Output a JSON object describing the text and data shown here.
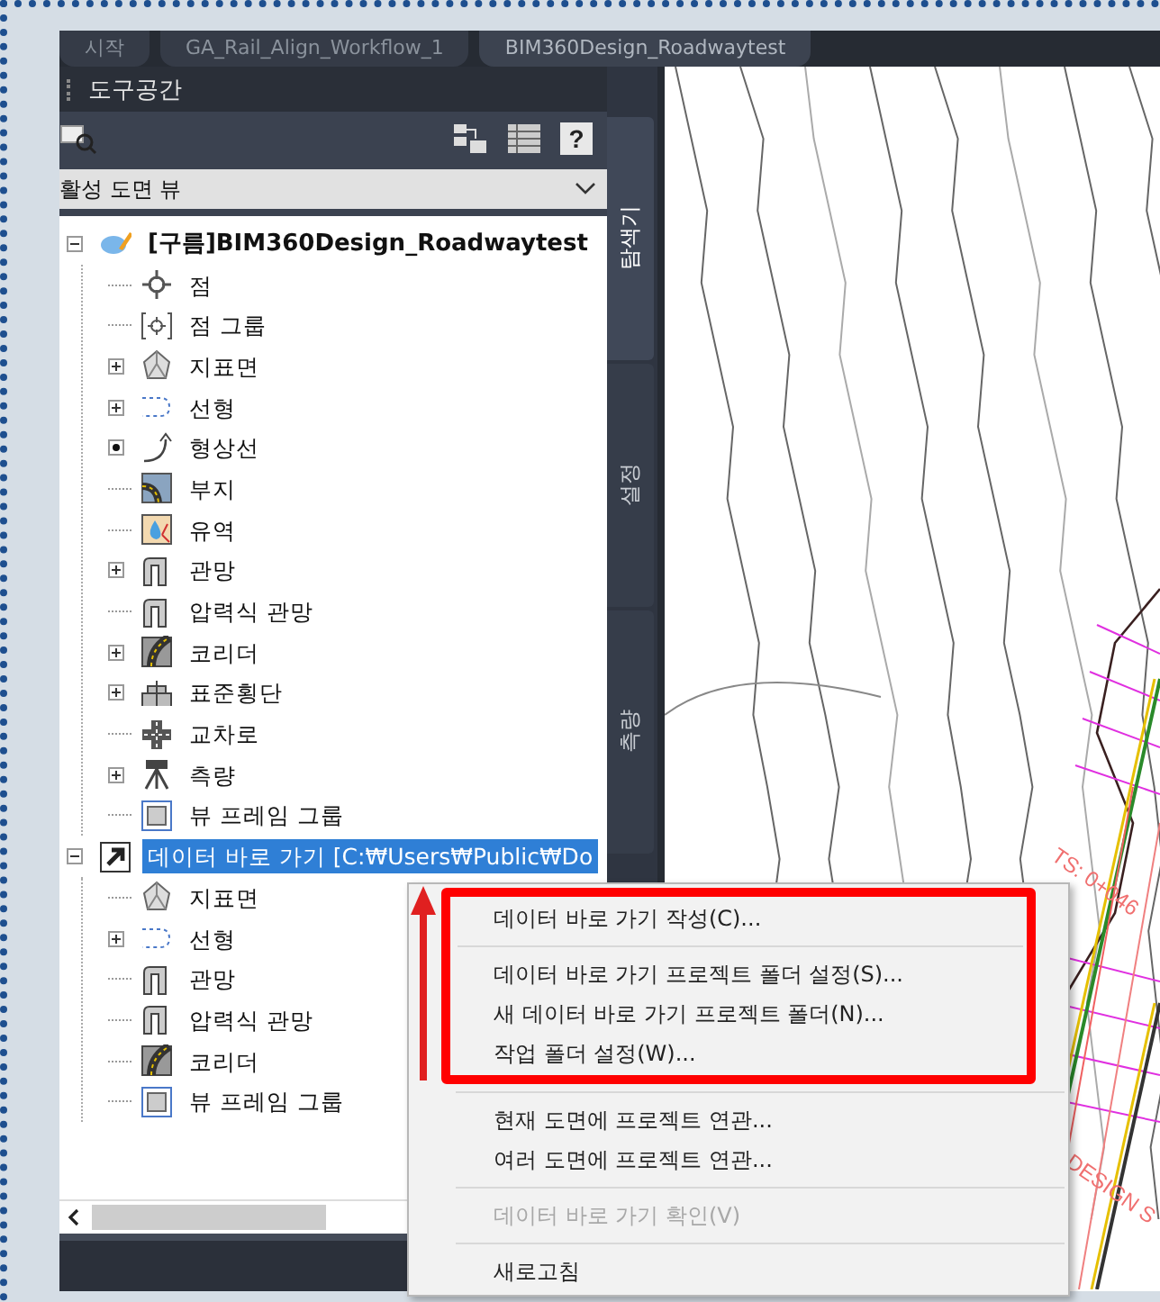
{
  "tabs": [
    {
      "label": "시작",
      "selected": false
    },
    {
      "label": "GA_Rail_Align_Workflow_1",
      "selected": false
    },
    {
      "label": "BIM360Design_Roadwaytest",
      "selected": true
    }
  ],
  "toolspace": {
    "title": "도구공간",
    "help_button": "?",
    "view_dropdown": {
      "value": "활성 도면 뷰"
    },
    "tree": [
      {
        "label": "[구름]BIM360Design_Roadwaytest",
        "kind": "expandable",
        "expanded": true,
        "selected": false,
        "children": [
          {
            "label": "점",
            "kind": "leaf",
            "selected": false
          },
          {
            "label": "점 그룹",
            "kind": "leaf",
            "selected": false
          },
          {
            "label": "지표면",
            "kind": "expandable",
            "expanded": false,
            "selected": false
          },
          {
            "label": "선형",
            "kind": "expandable",
            "expanded": false,
            "selected": false
          },
          {
            "label": "형상선",
            "kind": "dot-box",
            "selected": false
          },
          {
            "label": "부지",
            "kind": "leaf",
            "selected": false
          },
          {
            "label": "유역",
            "kind": "leaf",
            "selected": false
          },
          {
            "label": "관망",
            "kind": "expandable",
            "expanded": false,
            "selected": false
          },
          {
            "label": "압력식 관망",
            "kind": "leaf",
            "selected": false
          },
          {
            "label": "코리더",
            "kind": "expandable",
            "expanded": false,
            "selected": false
          },
          {
            "label": "표준횡단",
            "kind": "expandable",
            "expanded": false,
            "selected": false
          },
          {
            "label": "교차로",
            "kind": "leaf",
            "selected": false
          },
          {
            "label": "측량",
            "kind": "expandable",
            "expanded": false,
            "selected": false
          },
          {
            "label": "뷰 프레임 그룹",
            "kind": "leaf",
            "selected": false
          }
        ]
      },
      {
        "label": "데이터 바로 가기 [C:₩Users₩Public₩Do",
        "kind": "expandable",
        "expanded": true,
        "selected": true,
        "children": [
          {
            "label": "지표면",
            "kind": "leaf",
            "selected": false
          },
          {
            "label": "선형",
            "kind": "expandable",
            "expanded": false,
            "selected": false
          },
          {
            "label": "관망",
            "kind": "leaf",
            "selected": false
          },
          {
            "label": "압력식 관망",
            "kind": "leaf",
            "selected": false
          },
          {
            "label": "코리더",
            "kind": "leaf",
            "selected": false
          },
          {
            "label": "뷰 프레임 그룹",
            "kind": "leaf",
            "selected": false
          }
        ]
      }
    ],
    "side_tabs": [
      {
        "label": "탐색기",
        "selected": true
      },
      {
        "label": "설정",
        "selected": false
      },
      {
        "label": "측량",
        "selected": false
      }
    ]
  },
  "context_menu": {
    "groups": [
      [
        {
          "label": "데이터 바로 가기 작성(C)...",
          "disabled": false
        }
      ],
      [
        {
          "label": "데이터 바로 가기 프로젝트 폴더 설정(S)...",
          "disabled": false
        },
        {
          "label": "새 데이터 바로 가기 프로젝트 폴더(N)...",
          "disabled": false
        },
        {
          "label": "작업 폴더 설정(W)...",
          "disabled": false
        }
      ],
      [
        {
          "label": "현재 도면에 프로젝트 연관...",
          "disabled": false
        },
        {
          "label": "여러 도면에 프로젝트 연관...",
          "disabled": false
        }
      ],
      [
        {
          "label": "데이터 바로 가기 확인(V)",
          "disabled": true
        }
      ],
      [
        {
          "label": "새로고침",
          "disabled": false
        }
      ]
    ]
  },
  "drawing": {
    "labels": [
      "TS: 0+046",
      "DESIGN S"
    ]
  }
}
